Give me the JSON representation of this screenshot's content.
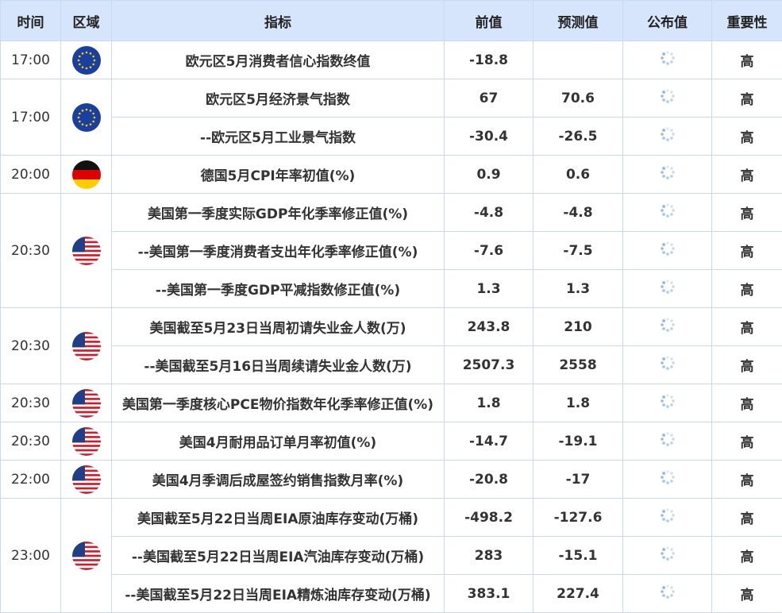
{
  "headers": {
    "time": "时间",
    "region": "区域",
    "indicator": "指标",
    "prev": "前值",
    "forecast": "预测值",
    "actual": "公布值",
    "importance": "重要性"
  },
  "groups": [
    {
      "time": "17:00",
      "flag": "eu-flag-icon",
      "rows": [
        {
          "indicator": "欧元区5月消费者信心指数终值",
          "prev": "-18.8",
          "forecast": "",
          "importance": "高"
        }
      ]
    },
    {
      "time": "17:00",
      "flag": "eu-flag-icon",
      "rows": [
        {
          "indicator": "欧元区5月经济景气指数",
          "prev": "67",
          "forecast": "70.6",
          "importance": "高"
        },
        {
          "indicator": "--欧元区5月工业景气指数",
          "prev": "-30.4",
          "forecast": "-26.5",
          "importance": "高"
        }
      ]
    },
    {
      "time": "20:00",
      "flag": "germany-flag-icon",
      "rows": [
        {
          "indicator": "德国5月CPI年率初值(%)",
          "prev": "0.9",
          "forecast": "0.6",
          "importance": "高"
        }
      ]
    },
    {
      "time": "20:30",
      "flag": "us-flag-icon",
      "rows": [
        {
          "indicator": "美国第一季度实际GDP年化季率修正值(%)",
          "prev": "-4.8",
          "forecast": "-4.8",
          "importance": "高"
        },
        {
          "indicator": "--美国第一季度消费者支出年化季率修正值(%)",
          "prev": "-7.6",
          "forecast": "-7.5",
          "importance": "高"
        },
        {
          "indicator": "--美国第一季度GDP平减指数修正值(%)",
          "prev": "1.3",
          "forecast": "1.3",
          "importance": "高"
        }
      ]
    },
    {
      "time": "20:30",
      "flag": "us-flag-icon",
      "rows": [
        {
          "indicator": "美国截至5月23日当周初请失业金人数(万)",
          "prev": "243.8",
          "forecast": "210",
          "importance": "高"
        },
        {
          "indicator": "--美国截至5月16日当周续请失业金人数(万)",
          "prev": "2507.3",
          "forecast": "2558",
          "importance": "高"
        }
      ]
    },
    {
      "time": "20:30",
      "flag": "us-flag-icon",
      "rows": [
        {
          "indicator": "美国第一季度核心PCE物价指数年化季率修正值(%)",
          "prev": "1.8",
          "forecast": "1.8",
          "importance": "高"
        }
      ]
    },
    {
      "time": "20:30",
      "flag": "us-flag-icon",
      "rows": [
        {
          "indicator": "美国4月耐用品订单月率初值(%)",
          "prev": "-14.7",
          "forecast": "-19.1",
          "importance": "高"
        }
      ]
    },
    {
      "time": "22:00",
      "flag": "us-flag-icon",
      "rows": [
        {
          "indicator": "美国4月季调后成屋签约销售指数月率(%)",
          "prev": "-20.8",
          "forecast": "-17",
          "importance": "高"
        }
      ]
    },
    {
      "time": "23:00",
      "flag": "us-flag-icon",
      "rows": [
        {
          "indicator": "美国截至5月22日当周EIA原油库存变动(万桶)",
          "prev": "-498.2",
          "forecast": "-127.6",
          "importance": "高"
        },
        {
          "indicator": "--美国截至5月22日当周EIA汽油库存变动(万桶)",
          "prev": "283",
          "forecast": "-15.1",
          "importance": "高"
        },
        {
          "indicator": "--美国截至5月22日当周EIA精炼油库存变动(万桶)",
          "prev": "383.1",
          "forecast": "227.4",
          "importance": "高"
        }
      ]
    }
  ],
  "colors": {
    "header_bg": "#d6e5fb",
    "border": "#c9daf0",
    "accent_red": "#c4261b",
    "eu_blue": "#1b3fa0",
    "eu_star": "#f5d000",
    "us_red": "#c8202f",
    "us_blue": "#223e86"
  }
}
